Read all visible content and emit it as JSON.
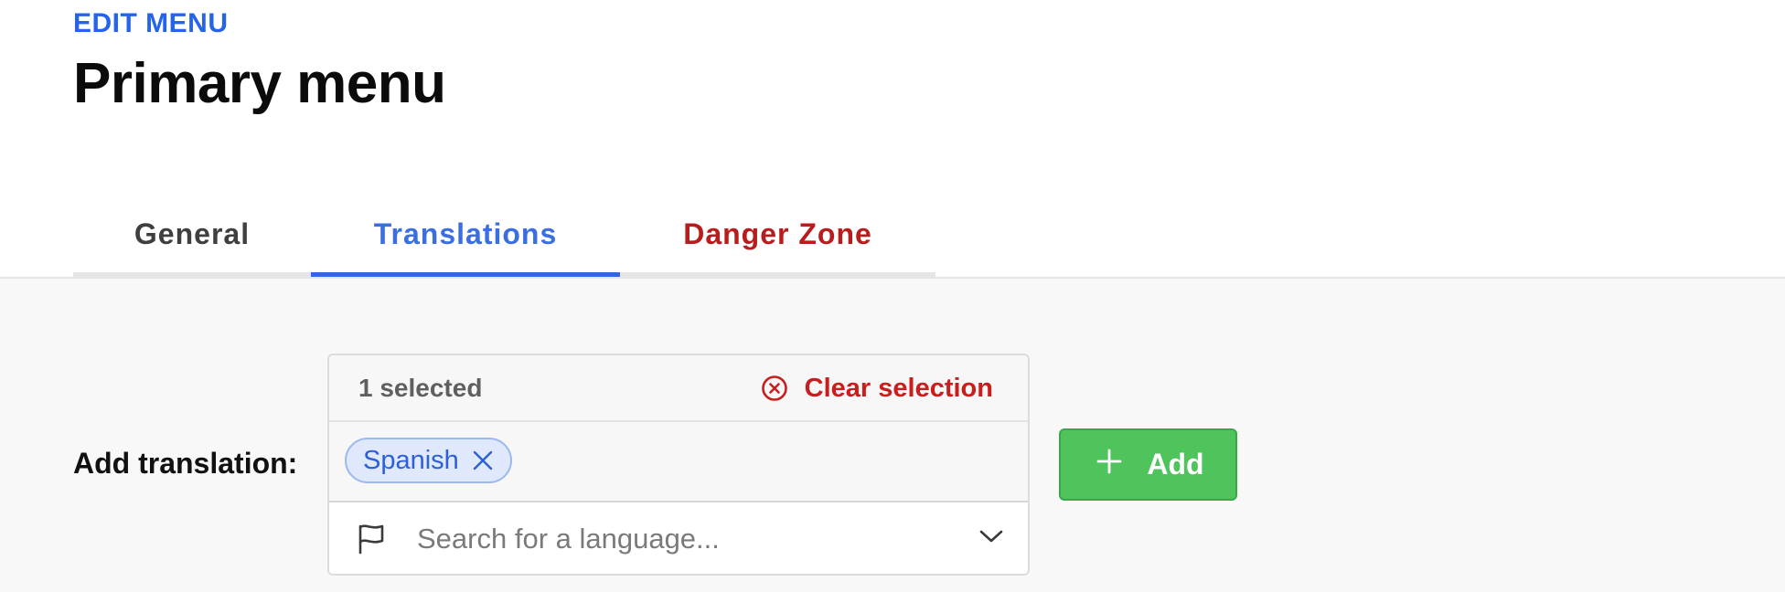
{
  "header": {
    "eyebrow": "EDIT MENU",
    "title": "Primary menu"
  },
  "tabs": [
    {
      "label": "General",
      "active": false
    },
    {
      "label": "Translations",
      "active": true
    },
    {
      "label": "Danger Zone",
      "active": false
    }
  ],
  "form": {
    "label": "Add translation:",
    "selected_count": "1 selected",
    "clear_label": "Clear selection",
    "chips": [
      {
        "label": "Spanish"
      }
    ],
    "search": {
      "placeholder": "Search for a language...",
      "value": ""
    },
    "add_label": "Add"
  },
  "icons": {
    "clear": "circle-x-icon",
    "chip_remove": "close-icon",
    "search": "flag-icon",
    "dropdown": "chevron-down-icon",
    "add": "plus-icon"
  },
  "colors": {
    "accent": "#2563eb",
    "danger": "#c81e1e",
    "success": "#4fc45d",
    "chip_bg": "#dfe9fb"
  }
}
